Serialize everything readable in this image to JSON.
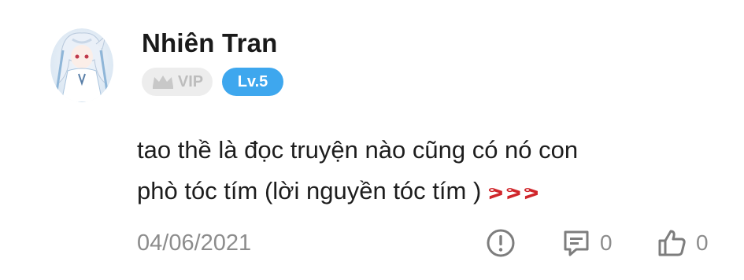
{
  "user": {
    "name": "Nhiên Tran",
    "vip_label": "VIP",
    "level_label": "Lv.5"
  },
  "comment": {
    "line1": "tao thề là đọc truyện nào cũng có nó con",
    "line2": "phò tóc tím  (lời nguyền tóc tím )",
    "emoji_text": "ᕗ ᕗ ᕗ"
  },
  "meta": {
    "date": "04/06/2021",
    "reply_count": "0",
    "like_count": "0"
  },
  "colors": {
    "level_badge": "#3ea7ee",
    "vip_badge_bg": "#ededed",
    "angry_emoji": "#d0262b"
  },
  "icons": [
    "report-icon",
    "reply-icon",
    "like-icon",
    "crown-icon"
  ]
}
